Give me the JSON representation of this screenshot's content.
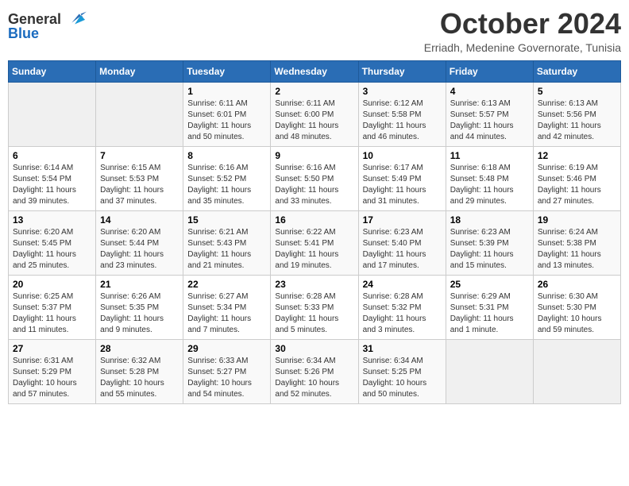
{
  "header": {
    "logo_general": "General",
    "logo_blue": "Blue",
    "month_title": "October 2024",
    "subtitle": "Erriadh, Medenine Governorate, Tunisia"
  },
  "days_of_week": [
    "Sunday",
    "Monday",
    "Tuesday",
    "Wednesday",
    "Thursday",
    "Friday",
    "Saturday"
  ],
  "weeks": [
    [
      {
        "day": "",
        "sunrise": "",
        "sunset": "",
        "daylight": "",
        "empty": true
      },
      {
        "day": "",
        "sunrise": "",
        "sunset": "",
        "daylight": "",
        "empty": true
      },
      {
        "day": "1",
        "sunrise": "Sunrise: 6:11 AM",
        "sunset": "Sunset: 6:01 PM",
        "daylight": "Daylight: 11 hours and 50 minutes.",
        "empty": false
      },
      {
        "day": "2",
        "sunrise": "Sunrise: 6:11 AM",
        "sunset": "Sunset: 6:00 PM",
        "daylight": "Daylight: 11 hours and 48 minutes.",
        "empty": false
      },
      {
        "day": "3",
        "sunrise": "Sunrise: 6:12 AM",
        "sunset": "Sunset: 5:58 PM",
        "daylight": "Daylight: 11 hours and 46 minutes.",
        "empty": false
      },
      {
        "day": "4",
        "sunrise": "Sunrise: 6:13 AM",
        "sunset": "Sunset: 5:57 PM",
        "daylight": "Daylight: 11 hours and 44 minutes.",
        "empty": false
      },
      {
        "day": "5",
        "sunrise": "Sunrise: 6:13 AM",
        "sunset": "Sunset: 5:56 PM",
        "daylight": "Daylight: 11 hours and 42 minutes.",
        "empty": false
      }
    ],
    [
      {
        "day": "6",
        "sunrise": "Sunrise: 6:14 AM",
        "sunset": "Sunset: 5:54 PM",
        "daylight": "Daylight: 11 hours and 39 minutes.",
        "empty": false
      },
      {
        "day": "7",
        "sunrise": "Sunrise: 6:15 AM",
        "sunset": "Sunset: 5:53 PM",
        "daylight": "Daylight: 11 hours and 37 minutes.",
        "empty": false
      },
      {
        "day": "8",
        "sunrise": "Sunrise: 6:16 AM",
        "sunset": "Sunset: 5:52 PM",
        "daylight": "Daylight: 11 hours and 35 minutes.",
        "empty": false
      },
      {
        "day": "9",
        "sunrise": "Sunrise: 6:16 AM",
        "sunset": "Sunset: 5:50 PM",
        "daylight": "Daylight: 11 hours and 33 minutes.",
        "empty": false
      },
      {
        "day": "10",
        "sunrise": "Sunrise: 6:17 AM",
        "sunset": "Sunset: 5:49 PM",
        "daylight": "Daylight: 11 hours and 31 minutes.",
        "empty": false
      },
      {
        "day": "11",
        "sunrise": "Sunrise: 6:18 AM",
        "sunset": "Sunset: 5:48 PM",
        "daylight": "Daylight: 11 hours and 29 minutes.",
        "empty": false
      },
      {
        "day": "12",
        "sunrise": "Sunrise: 6:19 AM",
        "sunset": "Sunset: 5:46 PM",
        "daylight": "Daylight: 11 hours and 27 minutes.",
        "empty": false
      }
    ],
    [
      {
        "day": "13",
        "sunrise": "Sunrise: 6:20 AM",
        "sunset": "Sunset: 5:45 PM",
        "daylight": "Daylight: 11 hours and 25 minutes.",
        "empty": false
      },
      {
        "day": "14",
        "sunrise": "Sunrise: 6:20 AM",
        "sunset": "Sunset: 5:44 PM",
        "daylight": "Daylight: 11 hours and 23 minutes.",
        "empty": false
      },
      {
        "day": "15",
        "sunrise": "Sunrise: 6:21 AM",
        "sunset": "Sunset: 5:43 PM",
        "daylight": "Daylight: 11 hours and 21 minutes.",
        "empty": false
      },
      {
        "day": "16",
        "sunrise": "Sunrise: 6:22 AM",
        "sunset": "Sunset: 5:41 PM",
        "daylight": "Daylight: 11 hours and 19 minutes.",
        "empty": false
      },
      {
        "day": "17",
        "sunrise": "Sunrise: 6:23 AM",
        "sunset": "Sunset: 5:40 PM",
        "daylight": "Daylight: 11 hours and 17 minutes.",
        "empty": false
      },
      {
        "day": "18",
        "sunrise": "Sunrise: 6:23 AM",
        "sunset": "Sunset: 5:39 PM",
        "daylight": "Daylight: 11 hours and 15 minutes.",
        "empty": false
      },
      {
        "day": "19",
        "sunrise": "Sunrise: 6:24 AM",
        "sunset": "Sunset: 5:38 PM",
        "daylight": "Daylight: 11 hours and 13 minutes.",
        "empty": false
      }
    ],
    [
      {
        "day": "20",
        "sunrise": "Sunrise: 6:25 AM",
        "sunset": "Sunset: 5:37 PM",
        "daylight": "Daylight: 11 hours and 11 minutes.",
        "empty": false
      },
      {
        "day": "21",
        "sunrise": "Sunrise: 6:26 AM",
        "sunset": "Sunset: 5:35 PM",
        "daylight": "Daylight: 11 hours and 9 minutes.",
        "empty": false
      },
      {
        "day": "22",
        "sunrise": "Sunrise: 6:27 AM",
        "sunset": "Sunset: 5:34 PM",
        "daylight": "Daylight: 11 hours and 7 minutes.",
        "empty": false
      },
      {
        "day": "23",
        "sunrise": "Sunrise: 6:28 AM",
        "sunset": "Sunset: 5:33 PM",
        "daylight": "Daylight: 11 hours and 5 minutes.",
        "empty": false
      },
      {
        "day": "24",
        "sunrise": "Sunrise: 6:28 AM",
        "sunset": "Sunset: 5:32 PM",
        "daylight": "Daylight: 11 hours and 3 minutes.",
        "empty": false
      },
      {
        "day": "25",
        "sunrise": "Sunrise: 6:29 AM",
        "sunset": "Sunset: 5:31 PM",
        "daylight": "Daylight: 11 hours and 1 minute.",
        "empty": false
      },
      {
        "day": "26",
        "sunrise": "Sunrise: 6:30 AM",
        "sunset": "Sunset: 5:30 PM",
        "daylight": "Daylight: 10 hours and 59 minutes.",
        "empty": false
      }
    ],
    [
      {
        "day": "27",
        "sunrise": "Sunrise: 6:31 AM",
        "sunset": "Sunset: 5:29 PM",
        "daylight": "Daylight: 10 hours and 57 minutes.",
        "empty": false
      },
      {
        "day": "28",
        "sunrise": "Sunrise: 6:32 AM",
        "sunset": "Sunset: 5:28 PM",
        "daylight": "Daylight: 10 hours and 55 minutes.",
        "empty": false
      },
      {
        "day": "29",
        "sunrise": "Sunrise: 6:33 AM",
        "sunset": "Sunset: 5:27 PM",
        "daylight": "Daylight: 10 hours and 54 minutes.",
        "empty": false
      },
      {
        "day": "30",
        "sunrise": "Sunrise: 6:34 AM",
        "sunset": "Sunset: 5:26 PM",
        "daylight": "Daylight: 10 hours and 52 minutes.",
        "empty": false
      },
      {
        "day": "31",
        "sunrise": "Sunrise: 6:34 AM",
        "sunset": "Sunset: 5:25 PM",
        "daylight": "Daylight: 10 hours and 50 minutes.",
        "empty": false
      },
      {
        "day": "",
        "sunrise": "",
        "sunset": "",
        "daylight": "",
        "empty": true
      },
      {
        "day": "",
        "sunrise": "",
        "sunset": "",
        "daylight": "",
        "empty": true
      }
    ]
  ]
}
